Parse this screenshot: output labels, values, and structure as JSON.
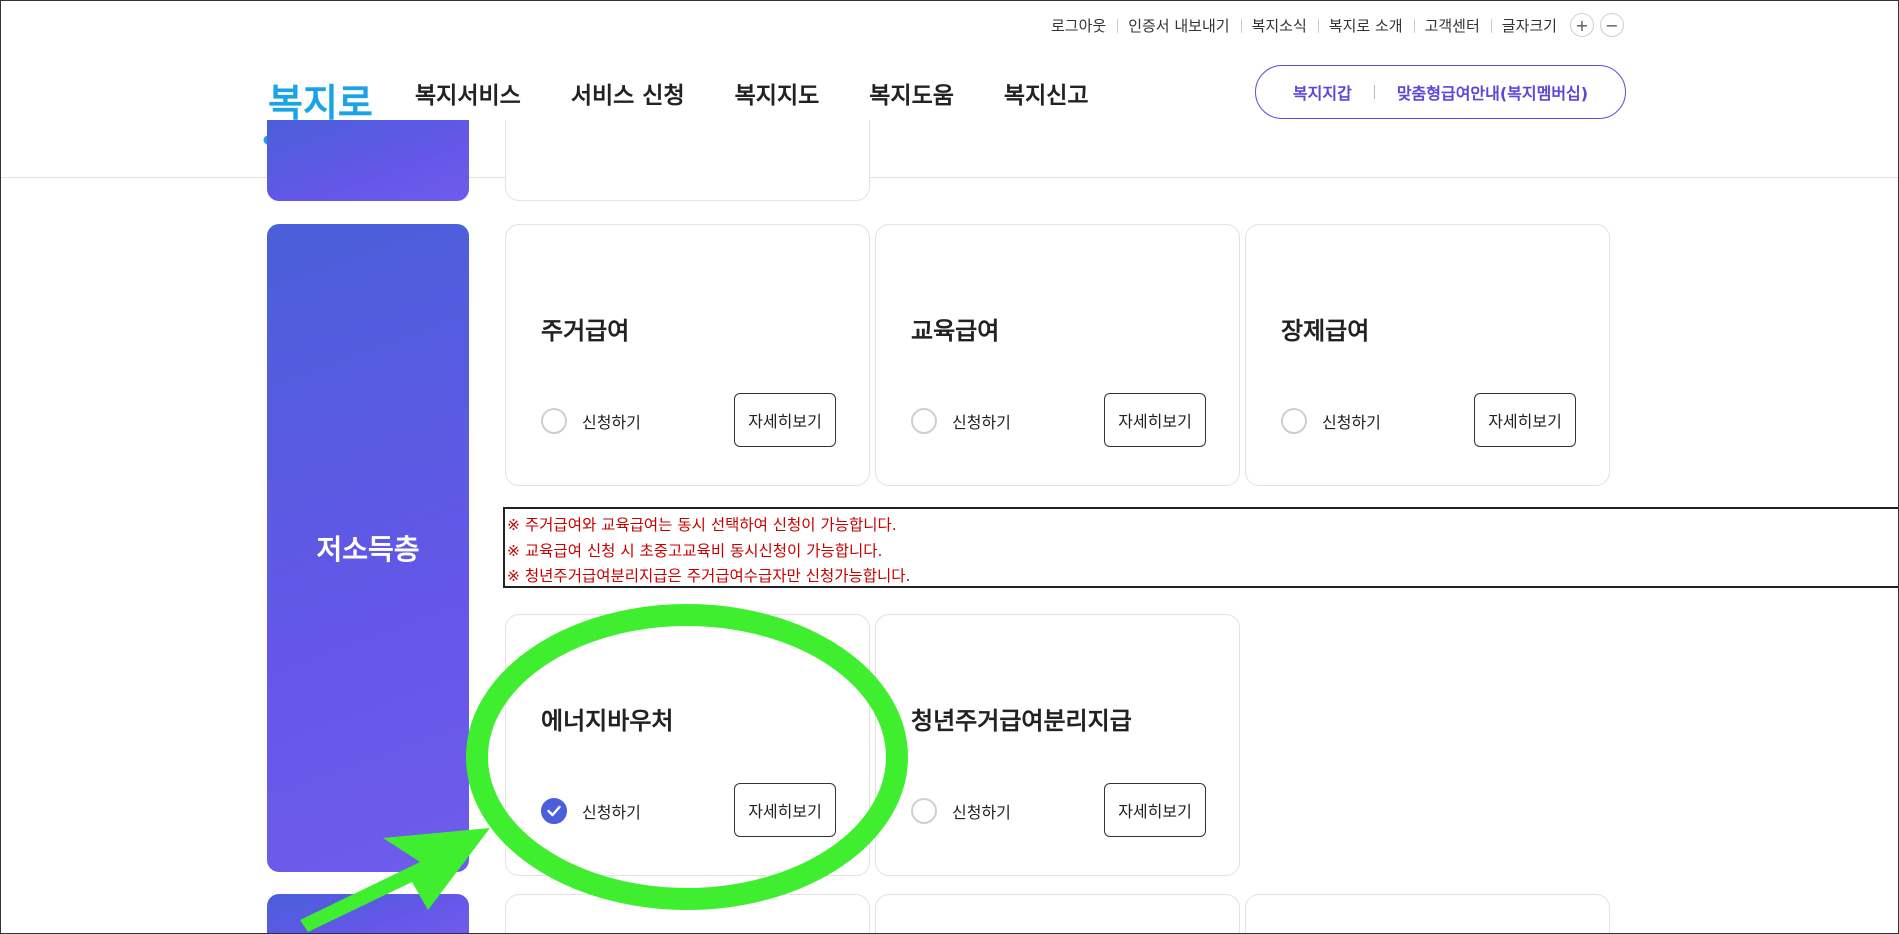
{
  "utility": {
    "items": [
      "로그아웃",
      "인증서 내보내기",
      "복지소식",
      "복지로 소개",
      "고객센터"
    ],
    "font_size_label": "글자크기",
    "font_plus": "+",
    "font_minus": "−"
  },
  "header": {
    "logo_text": "복지로",
    "nav": [
      "복지서비스",
      "서비스 신청",
      "복지지도",
      "복지도움",
      "복지신고"
    ],
    "pill_left": "복지지갑",
    "pill_right": "맞춤형급여안내(복지멤버십)"
  },
  "category": {
    "label": "저소득층"
  },
  "cards_row1": [
    {
      "title": "주거급여",
      "apply_label": "신청하기",
      "detail_label": "자세히보기",
      "checked": false
    },
    {
      "title": "교육급여",
      "apply_label": "신청하기",
      "detail_label": "자세히보기",
      "checked": false
    },
    {
      "title": "장제급여",
      "apply_label": "신청하기",
      "detail_label": "자세히보기",
      "checked": false
    }
  ],
  "notice": [
    "※ 주거급여와 교육급여는 동시 선택하여 신청이 가능합니다.",
    "※ 교육급여 신청 시 초중고교육비 동시신청이 가능합니다.",
    "※ 청년주거급여분리지급은 주거급여수급자만 신청가능합니다."
  ],
  "cards_row2": [
    {
      "title": "에너지바우처",
      "apply_label": "신청하기",
      "detail_label": "자세히보기",
      "checked": true
    },
    {
      "title": "청년주거급여분리지급",
      "apply_label": "신청하기",
      "detail_label": "자세히보기",
      "checked": false
    }
  ],
  "colors": {
    "brand": "#5b47d8",
    "category_gradient_start": "#4a5fd9",
    "category_gradient_end": "#6f5cec",
    "notice_text": "#c80000",
    "annotation": "#3fee2f",
    "logo_blue": "#1aa3e8"
  }
}
